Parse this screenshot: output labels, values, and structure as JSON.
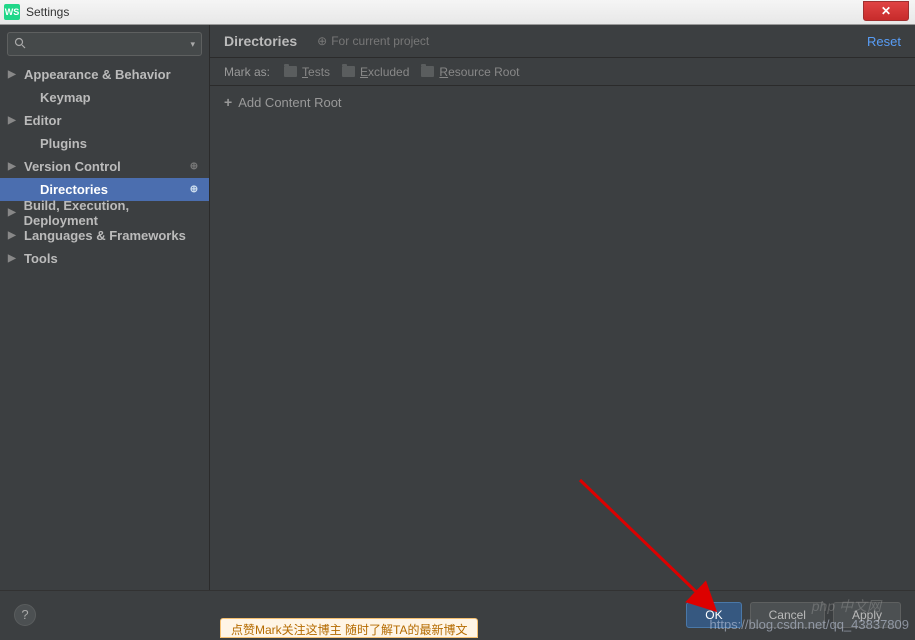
{
  "window": {
    "title": "Settings",
    "icon_label": "WS"
  },
  "search": {
    "placeholder": ""
  },
  "sidebar": {
    "items": [
      {
        "label": "Appearance & Behavior",
        "arrow": true,
        "bold": true,
        "child": false,
        "badge": ""
      },
      {
        "label": "Keymap",
        "arrow": false,
        "bold": true,
        "child": true,
        "badge": ""
      },
      {
        "label": "Editor",
        "arrow": true,
        "bold": true,
        "child": false,
        "badge": ""
      },
      {
        "label": "Plugins",
        "arrow": false,
        "bold": true,
        "child": true,
        "badge": ""
      },
      {
        "label": "Version Control",
        "arrow": true,
        "bold": true,
        "child": false,
        "badge": "⊕"
      },
      {
        "label": "Directories",
        "arrow": false,
        "bold": true,
        "child": true,
        "badge": "⊕",
        "selected": true
      },
      {
        "label": "Build, Execution, Deployment",
        "arrow": true,
        "bold": true,
        "child": false,
        "badge": ""
      },
      {
        "label": "Languages & Frameworks",
        "arrow": true,
        "bold": true,
        "child": false,
        "badge": ""
      },
      {
        "label": "Tools",
        "arrow": true,
        "bold": true,
        "child": false,
        "badge": ""
      }
    ]
  },
  "content": {
    "title": "Directories",
    "project_label": "For current project",
    "reset": "Reset",
    "markas_label": "Mark as:",
    "mark_tests": "Tests",
    "mark_excluded": "Excluded",
    "mark_resource": "Resource Root",
    "add_root": "Add Content Root"
  },
  "buttons": {
    "ok": "OK",
    "cancel": "Cancel",
    "apply": "Apply",
    "help": "?"
  },
  "watermark": "https://blog.csdn.net/qq_43837809",
  "orange_tip": "点赞Mark关注这博主  随时了解TA的最新博文",
  "php_badge": "php 中文网"
}
